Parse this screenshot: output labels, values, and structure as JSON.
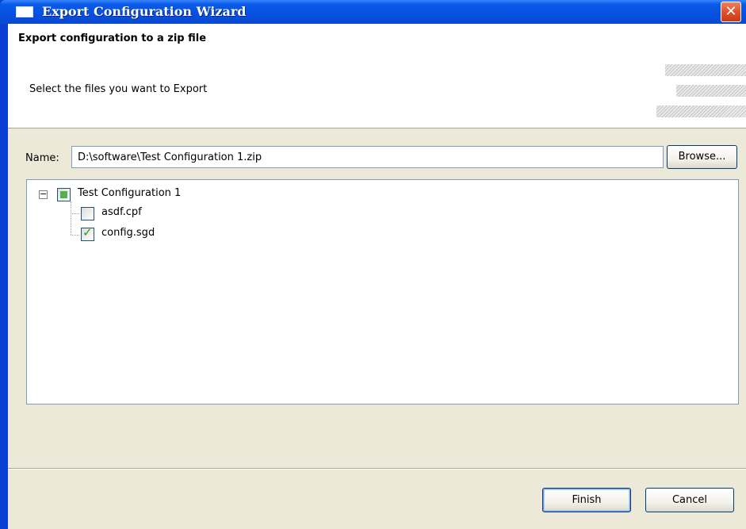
{
  "window": {
    "title": "Export Configuration Wizard",
    "close_glyph": "✕"
  },
  "header": {
    "title": "Export configuration to a zip file",
    "subtitle": "Select the files you want to Export"
  },
  "form": {
    "name_label": "Name:",
    "name_value": "D:\\software\\Test Configuration 1.zip",
    "browse_label": "Browse..."
  },
  "tree": {
    "root": {
      "label": "Test Configuration 1",
      "state": "partial",
      "expanded": true,
      "expander_glyph": "−"
    },
    "children": [
      {
        "label": "asdf.cpf",
        "checked": false
      },
      {
        "label": "config.sgd",
        "checked": true,
        "check_glyph": "✓"
      }
    ]
  },
  "footer": {
    "finish_label": "Finish",
    "cancel_label": "Cancel"
  },
  "colors": {
    "titlebar": "#0a5ae8",
    "dialog_bg": "#ece9d8",
    "check_green": "#21a121",
    "partial_green": "#55b04b"
  },
  "icons": {
    "window": "window-icon",
    "close": "close-icon",
    "expander": "collapse-icon",
    "checkbox": "checkbox-icon"
  }
}
